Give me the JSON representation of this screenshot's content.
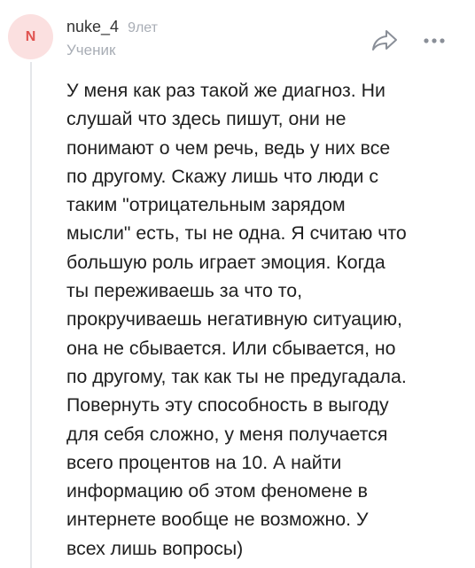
{
  "comment": {
    "avatar": {
      "letter": "N",
      "background_color": "#fbe0e0",
      "letter_color": "#e0524f"
    },
    "author": {
      "username": "nuke_4",
      "time_ago": "9лет",
      "rank": "Ученик"
    },
    "actions": {
      "share_icon": "share-arrow-icon",
      "more_icon": "more-dots-icon"
    },
    "text": "У меня как раз такой же диагноз. Ни\nслушай что здесь пишут, они не\nпонимают о чем речь, ведь у них все\nпо другому. Скажу лишь что люди с\nтаким \"отрицательным зарядом\nмысли\" есть, ты не одна. Я считаю что\nбольшую роль играет эмоция. Когда\nты переживаешь за что то,\nпрокручиваешь негативную ситуацию,\nона не сбывается. Или сбывается, но\nпо другому, так как ты не предугадала.\nПовернуть эту способность в выгоду\nдля себя сложно, у меня получается\nвсего процентов на 10. А найти\nинформацию об этом феномене в\nинтернете вообще не возможно. У\nвсех лишь вопросы)"
  }
}
